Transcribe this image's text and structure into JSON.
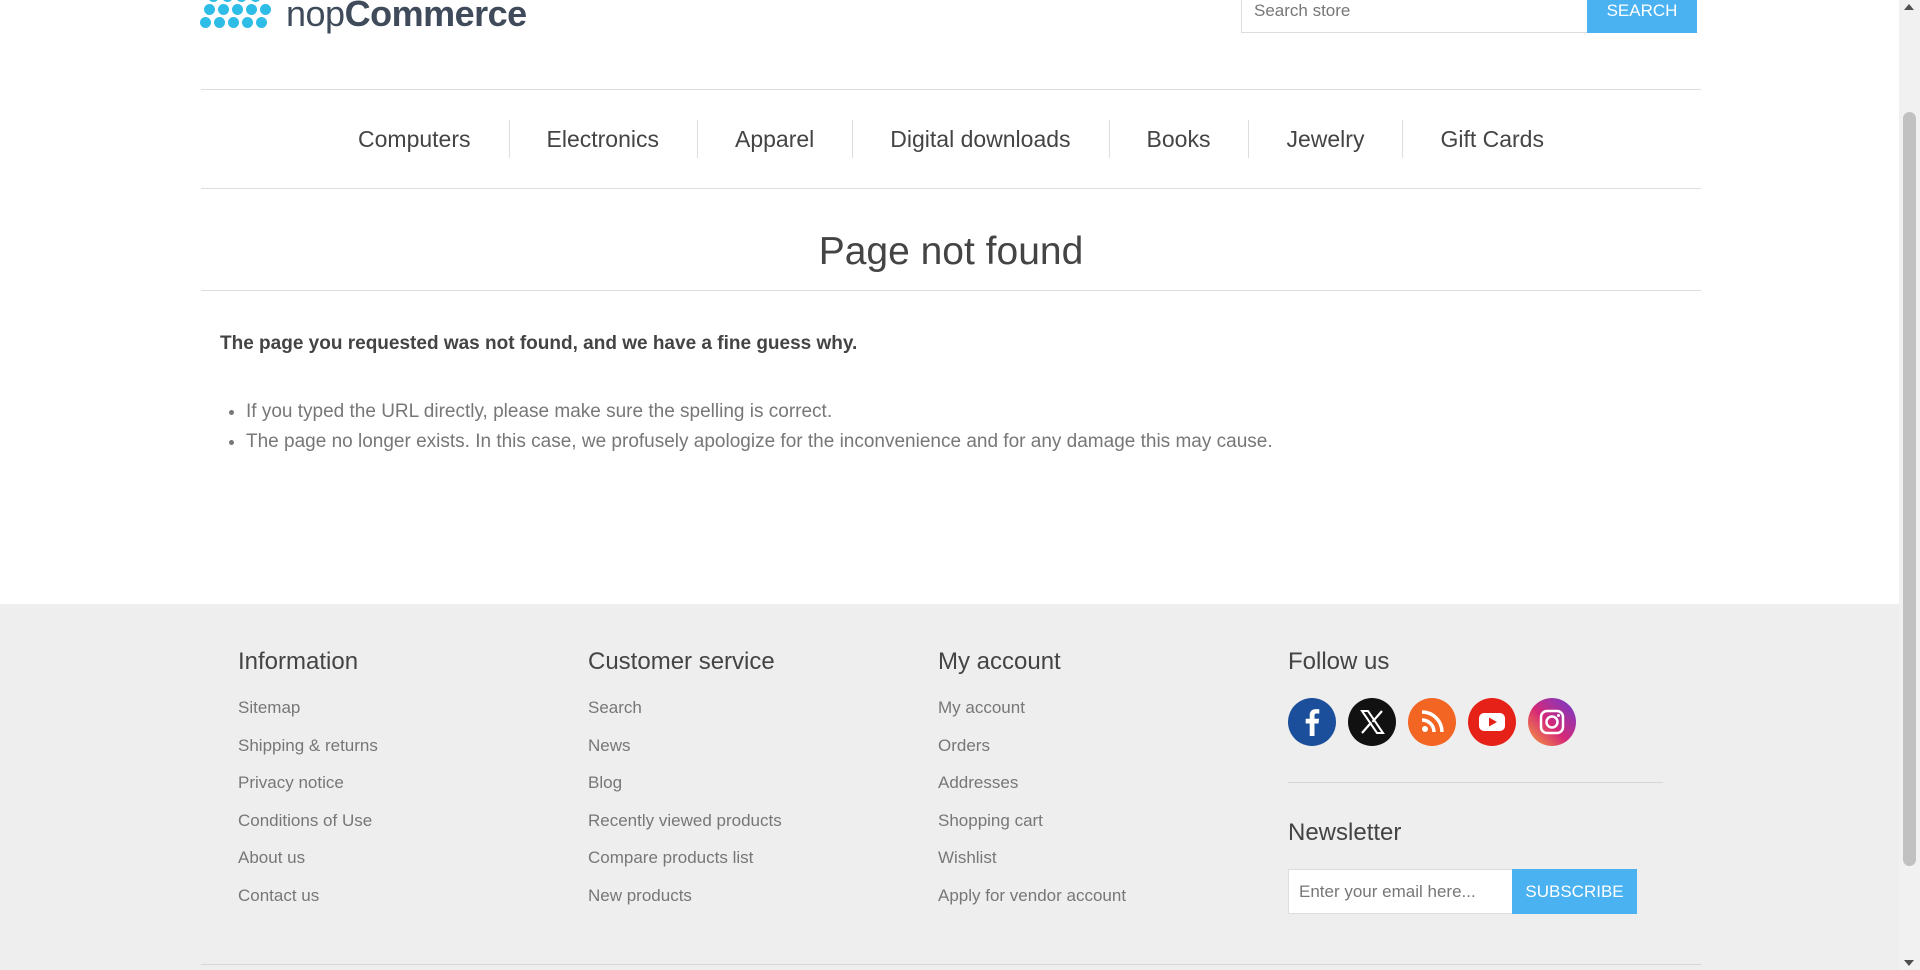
{
  "header": {
    "logo": {
      "text_light": "nop",
      "text_bold": "Commerce",
      "icon": "nopcommerce-dots-logo"
    },
    "search": {
      "placeholder": "Search store",
      "button_label": "SEARCH"
    }
  },
  "menu": {
    "items": [
      {
        "label": "Computers"
      },
      {
        "label": "Electronics"
      },
      {
        "label": "Apparel"
      },
      {
        "label": "Digital downloads"
      },
      {
        "label": "Books"
      },
      {
        "label": "Jewelry"
      },
      {
        "label": "Gift Cards"
      }
    ]
  },
  "main": {
    "title": "Page not found",
    "lead": "The page you requested was not found, and we have a fine guess why.",
    "reasons": [
      "If you typed the URL directly, please make sure the spelling is correct.",
      "The page no longer exists. In this case, we profusely apologize for the inconvenience and for any damage this may cause."
    ]
  },
  "footer": {
    "information": {
      "title": "Information",
      "links": [
        "Sitemap",
        "Shipping & returns",
        "Privacy notice",
        "Conditions of Use",
        "About us",
        "Contact us"
      ]
    },
    "customer_service": {
      "title": "Customer service",
      "links": [
        "Search",
        "News",
        "Blog",
        "Recently viewed products",
        "Compare products list",
        "New products"
      ]
    },
    "my_account": {
      "title": "My account",
      "links": [
        "My account",
        "Orders",
        "Addresses",
        "Shopping cart",
        "Wishlist",
        "Apply for vendor account"
      ]
    },
    "follow_us": {
      "title": "Follow us",
      "icons": [
        {
          "name": "facebook-icon",
          "color": "#1b4f9c"
        },
        {
          "name": "x-twitter-icon",
          "color": "#111111"
        },
        {
          "name": "rss-icon",
          "color": "#f26522"
        },
        {
          "name": "youtube-icon",
          "color": "#e62117"
        },
        {
          "name": "instagram-icon",
          "color": "#c13584"
        }
      ]
    },
    "newsletter": {
      "title": "Newsletter",
      "placeholder": "Enter your email here...",
      "button_label": "SUBSCRIBE"
    }
  },
  "colors": {
    "accent": "#4ab2f1",
    "logo": "#2ebde6",
    "footer_bg": "#eeeeee"
  }
}
